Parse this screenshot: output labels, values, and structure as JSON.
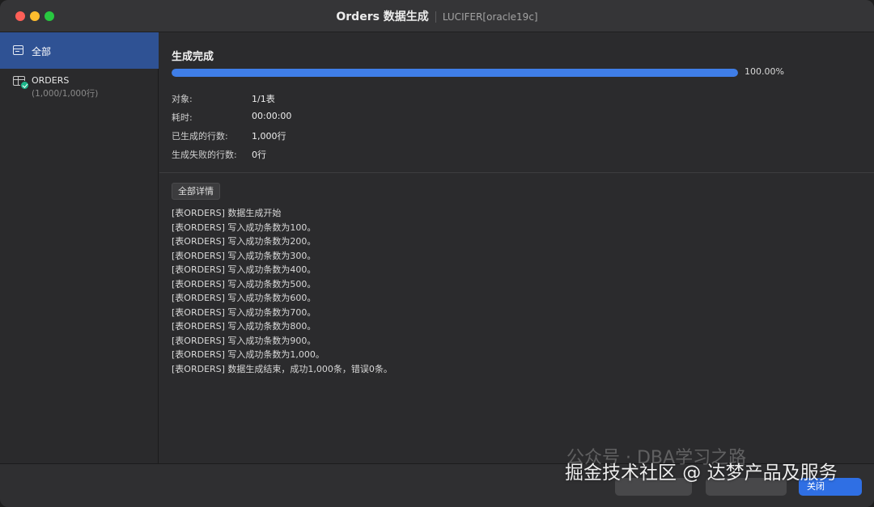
{
  "window": {
    "title": "Orders 数据生成",
    "subtitle": "LUCIFER[oracle19c]"
  },
  "sidebar": {
    "items": [
      {
        "label": "全部",
        "icon": "list-icon",
        "selected": true
      },
      {
        "label": "ORDERS",
        "sublabel": "(1,000/1,000行)",
        "icon": "table-icon",
        "status": "success"
      }
    ]
  },
  "main": {
    "status_title": "生成完成",
    "progress": {
      "value": 1.0,
      "label": "100.00%",
      "color": "#3f7ee8"
    },
    "stats": [
      {
        "label": "对象:",
        "value": "1/1表"
      },
      {
        "label": "耗时:",
        "value": "00:00:00"
      },
      {
        "label": "已生成的行数:",
        "value": "1,000行"
      },
      {
        "label": "生成失败的行数:",
        "value": "0行"
      }
    ],
    "details_button": "全部详情",
    "log": [
      "[表ORDERS] 数据生成开始",
      "[表ORDERS] 写入成功条数为100。",
      "[表ORDERS] 写入成功条数为200。",
      "[表ORDERS] 写入成功条数为300。",
      "[表ORDERS] 写入成功条数为400。",
      "[表ORDERS] 写入成功条数为500。",
      "[表ORDERS] 写入成功条数为600。",
      "[表ORDERS] 写入成功条数为700。",
      "[表ORDERS] 写入成功条数为800。",
      "[表ORDERS] 写入成功条数为900。",
      "[表ORDERS] 写入成功条数为1,000。",
      "[表ORDERS] 数据生成结束，成功1,000条，错误0条。"
    ]
  },
  "footer": {
    "close_label": "关闭"
  },
  "watermark": {
    "text": "掘金技术社区 @ 达梦产品及服务",
    "faint_text": "公众号 · DBA学习之路"
  }
}
